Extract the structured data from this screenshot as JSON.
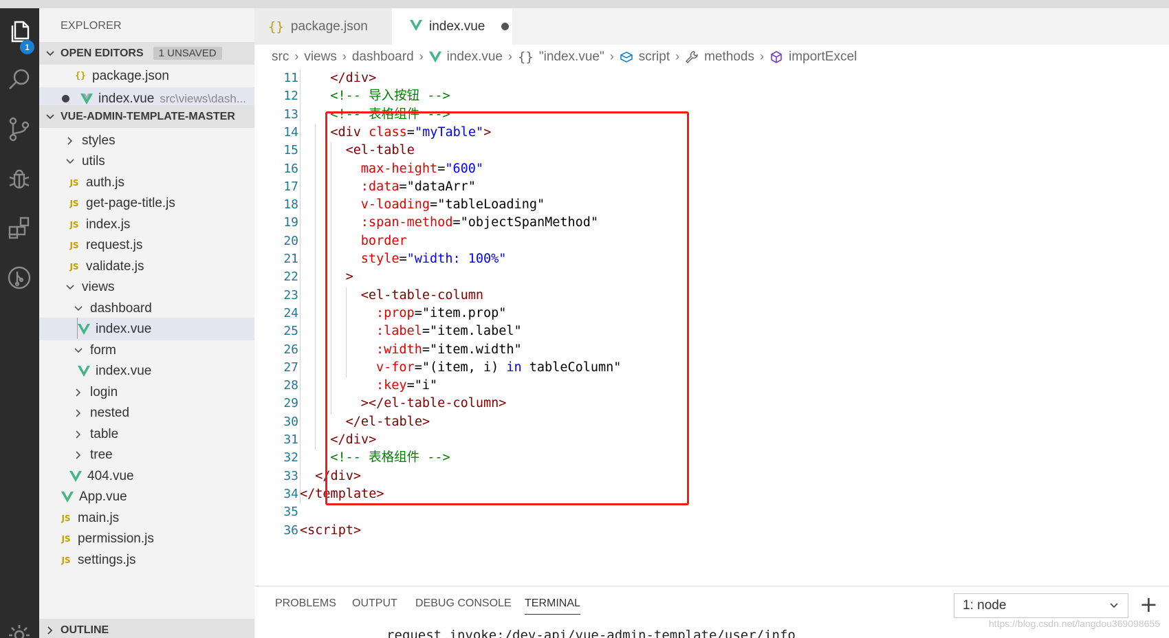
{
  "explorer": {
    "title": "EXPLORER",
    "open_editors": {
      "header": "OPEN EDITORS",
      "badge": "1 UNSAVED",
      "items": [
        {
          "label": "package.json",
          "path": ""
        },
        {
          "label": "index.vue",
          "path": "src\\views\\dash..."
        }
      ]
    },
    "project": {
      "header": "VUE-ADMIN-TEMPLATE-MASTER",
      "items": [
        {
          "label": "styles"
        },
        {
          "label": "utils"
        },
        {
          "label": "auth.js"
        },
        {
          "label": "get-page-title.js"
        },
        {
          "label": "index.js"
        },
        {
          "label": "request.js"
        },
        {
          "label": "validate.js"
        },
        {
          "label": "views"
        },
        {
          "label": "dashboard"
        },
        {
          "label": "index.vue"
        },
        {
          "label": "form"
        },
        {
          "label": "index.vue"
        },
        {
          "label": "login"
        },
        {
          "label": "nested"
        },
        {
          "label": "table"
        },
        {
          "label": "tree"
        },
        {
          "label": "404.vue"
        },
        {
          "label": "App.vue"
        },
        {
          "label": "main.js"
        },
        {
          "label": "permission.js"
        },
        {
          "label": "settings.js"
        }
      ]
    },
    "outline_header": "OUTLINE"
  },
  "activity_bar": {
    "badge": "1",
    "icons": [
      "files-icon",
      "search-icon",
      "source-control-icon",
      "debug-icon",
      "extensions-icon",
      "git-graph-icon",
      "settings-gear-icon"
    ]
  },
  "tabs": [
    {
      "label": "package.json"
    },
    {
      "label": "index.vue"
    }
  ],
  "breadcrumbs": [
    "src",
    "views",
    "dashboard",
    "index.vue",
    "\"index.vue\"",
    "script",
    "methods",
    "importExcel"
  ],
  "code": {
    "lines": [
      {
        "n": "11",
        "parts": [
          {
            "t": "</",
            "c": "t-tag"
          },
          {
            "t": "div",
            "c": "t-tag"
          },
          {
            "t": ">",
            "c": "t-tag"
          }
        ]
      },
      {
        "n": "12",
        "parts": [
          {
            "t": "<!-- 导入按钮 -->",
            "c": "t-com"
          }
        ]
      },
      {
        "n": "13",
        "parts": [
          {
            "t": "<!-- 表格组件 -->",
            "c": "t-com"
          }
        ]
      },
      {
        "n": "14",
        "parts": [
          {
            "t": "<div ",
            "c": "t-tag"
          },
          {
            "t": "class",
            "c": "t-attr"
          },
          {
            "t": "=",
            "c": "t-txt"
          },
          {
            "t": "\"myTable\"",
            "c": "t-str"
          },
          {
            "t": ">",
            "c": "t-tag"
          }
        ]
      },
      {
        "n": "15",
        "parts": [
          {
            "t": "<el-table",
            "c": "t-tag"
          }
        ]
      },
      {
        "n": "16",
        "parts": [
          {
            "t": "max-height",
            "c": "t-attr"
          },
          {
            "t": "=",
            "c": "t-txt"
          },
          {
            "t": "\"600\"",
            "c": "t-str"
          }
        ]
      },
      {
        "n": "17",
        "parts": [
          {
            "t": ":data",
            "c": "t-attr"
          },
          {
            "t": "=",
            "c": "t-txt"
          },
          {
            "t": "\"dataArr\"",
            "c": "t-txt"
          }
        ]
      },
      {
        "n": "18",
        "parts": [
          {
            "t": "v-loading",
            "c": "t-attr"
          },
          {
            "t": "=",
            "c": "t-txt"
          },
          {
            "t": "\"tableLoading\"",
            "c": "t-txt"
          }
        ]
      },
      {
        "n": "19",
        "parts": [
          {
            "t": ":span-method",
            "c": "t-attr"
          },
          {
            "t": "=",
            "c": "t-txt"
          },
          {
            "t": "\"objectSpanMethod\"",
            "c": "t-txt"
          }
        ]
      },
      {
        "n": "20",
        "parts": [
          {
            "t": "border",
            "c": "t-attr"
          }
        ]
      },
      {
        "n": "21",
        "parts": [
          {
            "t": "style",
            "c": "t-attr"
          },
          {
            "t": "=",
            "c": "t-txt"
          },
          {
            "t": "\"width: 100%\"",
            "c": "t-str"
          }
        ]
      },
      {
        "n": "22",
        "parts": [
          {
            "t": ">",
            "c": "t-tag"
          }
        ]
      },
      {
        "n": "23",
        "parts": [
          {
            "t": "<el-table-column",
            "c": "t-tag"
          }
        ]
      },
      {
        "n": "24",
        "parts": [
          {
            "t": ":prop",
            "c": "t-attr"
          },
          {
            "t": "=",
            "c": "t-txt"
          },
          {
            "t": "\"item.prop\"",
            "c": "t-txt"
          }
        ]
      },
      {
        "n": "25",
        "parts": [
          {
            "t": ":label",
            "c": "t-attr"
          },
          {
            "t": "=",
            "c": "t-txt"
          },
          {
            "t": "\"item.label\"",
            "c": "t-txt"
          }
        ]
      },
      {
        "n": "26",
        "parts": [
          {
            "t": ":width",
            "c": "t-attr"
          },
          {
            "t": "=",
            "c": "t-txt"
          },
          {
            "t": "\"item.width\"",
            "c": "t-txt"
          }
        ]
      },
      {
        "n": "27",
        "parts": [
          {
            "t": "v-for",
            "c": "t-attr"
          },
          {
            "t": "=\"(item, i) ",
            "c": "t-txt"
          },
          {
            "t": "in",
            "c": "t-kw"
          },
          {
            "t": " tableColumn\"",
            "c": "t-txt"
          }
        ]
      },
      {
        "n": "28",
        "parts": [
          {
            "t": ":key",
            "c": "t-attr"
          },
          {
            "t": "=",
            "c": "t-txt"
          },
          {
            "t": "\"i\"",
            "c": "t-txt"
          }
        ]
      },
      {
        "n": "29",
        "parts": [
          {
            "t": "></el-table-column>",
            "c": "t-tag"
          }
        ]
      },
      {
        "n": "30",
        "parts": [
          {
            "t": "</el-table>",
            "c": "t-tag"
          }
        ]
      },
      {
        "n": "31",
        "parts": [
          {
            "t": "</div>",
            "c": "t-tag"
          }
        ]
      },
      {
        "n": "32",
        "parts": [
          {
            "t": "<!-- 表格组件 -->",
            "c": "t-com"
          }
        ]
      },
      {
        "n": "33",
        "parts": [
          {
            "t": "</div>",
            "c": "t-tag"
          }
        ]
      },
      {
        "n": "34",
        "parts": [
          {
            "t": "</template>",
            "c": "t-tag"
          }
        ]
      },
      {
        "n": "35",
        "parts": []
      },
      {
        "n": "36",
        "parts": [
          {
            "t": "<script>",
            "c": "t-tag"
          }
        ]
      }
    ]
  },
  "panel": {
    "tabs": [
      "PROBLEMS",
      "OUTPUT",
      "DEBUG CONSOLE",
      "TERMINAL"
    ],
    "active_tab": "TERMINAL",
    "terminal_selected": "1: node",
    "terminal_text": "request invoke:/dev-api/vue-admin-template/user/info",
    "watermark": "https://blog.csdn.net/langdou369098655"
  },
  "colors": {
    "activity_bar": "#2c2c2c",
    "sidebar": "#f3f3f3",
    "highlight_box": "#ef1c1c",
    "vue_green": "#41b883",
    "badge_blue": "#1b7fd4"
  }
}
